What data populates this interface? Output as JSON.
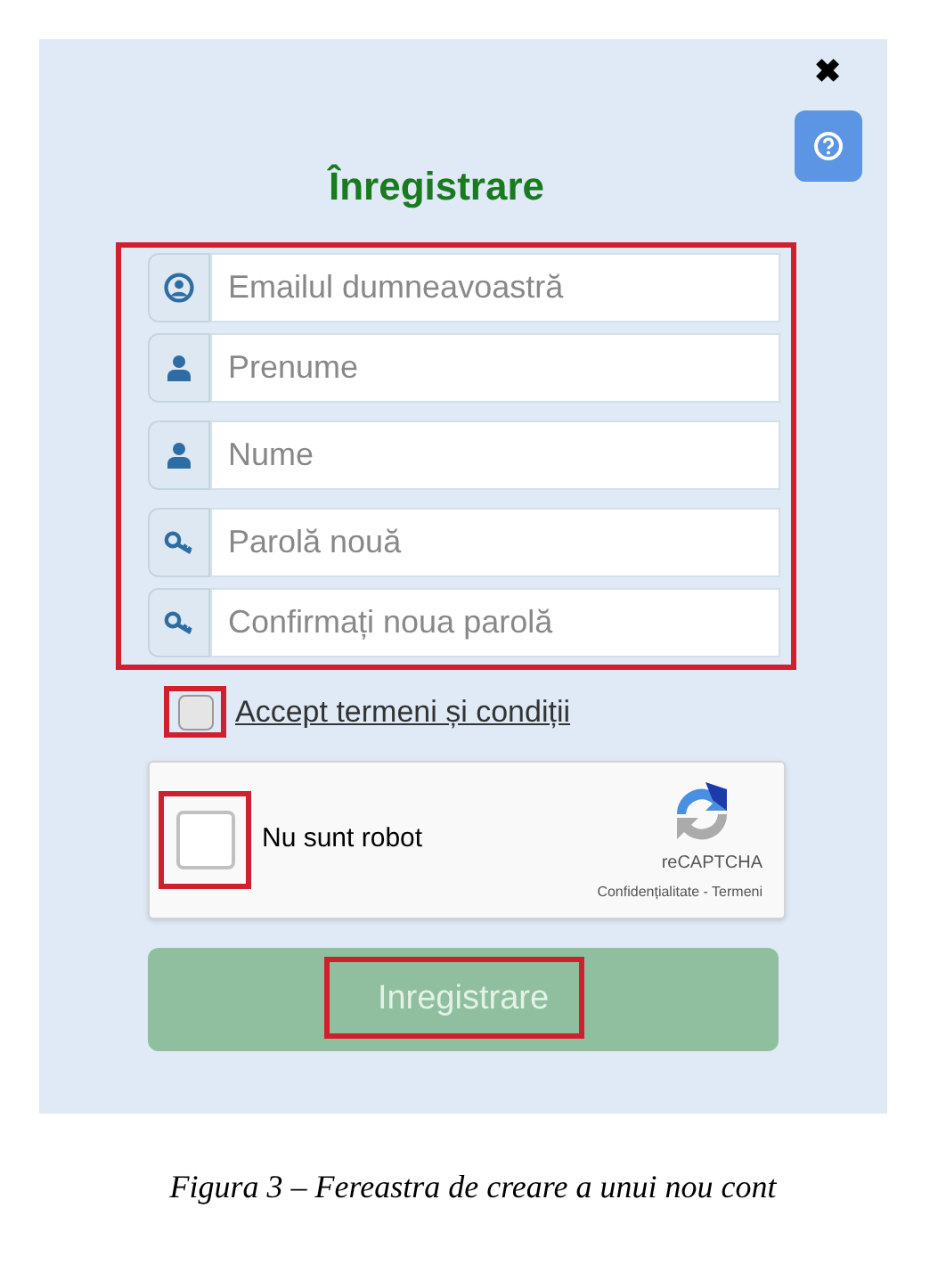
{
  "dialog": {
    "close": "✖",
    "title": "Înregistrare",
    "fields": [
      {
        "kind": "email",
        "placeholder": "Emailul dumneavoastră"
      },
      {
        "kind": "person",
        "placeholder": "Prenume"
      },
      {
        "kind": "person",
        "placeholder": "Nume"
      },
      {
        "kind": "key",
        "placeholder": "Parolă nouă"
      },
      {
        "kind": "key",
        "placeholder": "Confirmați noua parolă"
      }
    ],
    "terms": {
      "label": "Accept termeni și condiții",
      "checked": false
    },
    "captcha": {
      "label": "Nu sunt robot",
      "checked": false,
      "brand": "reCAPTCHA",
      "links": "Confidențialitate - Termeni"
    },
    "submit": {
      "label": "Inregistrare",
      "disabled": true
    }
  },
  "caption": "Figura 3 – Fereastra de creare a unui nou cont"
}
